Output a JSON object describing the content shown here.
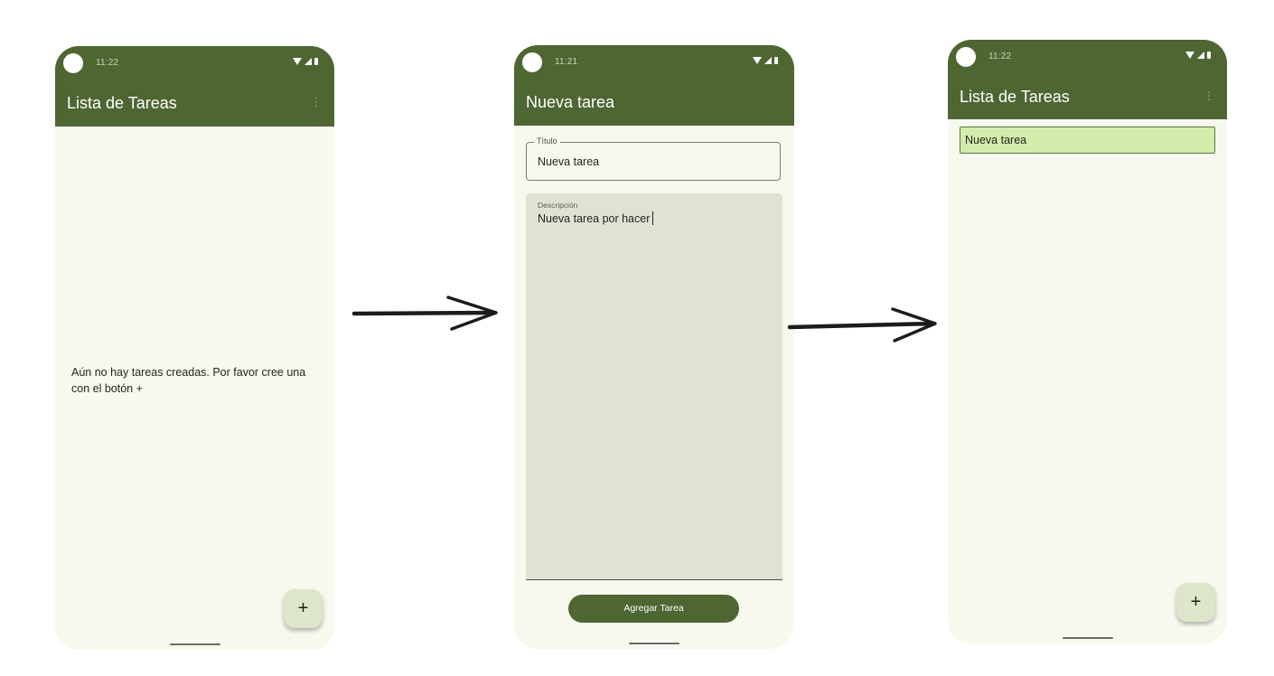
{
  "screens": [
    {
      "status_time": "11:22",
      "title": "Lista de Tareas",
      "empty_message": "Aún no hay tareas creadas. Por favor cree una con el botón +",
      "fab_label": "+"
    },
    {
      "status_time": "11:21",
      "title": "Nueva tarea",
      "title_field": {
        "label": "Título",
        "value": "Nueva tarea"
      },
      "description_field": {
        "label": "Descripción",
        "value": "Nueva tarea por hacer"
      },
      "submit_label": "Agregar Tarea"
    },
    {
      "status_time": "11:22",
      "title": "Lista de Tareas",
      "tasks": [
        {
          "title": "Nueva tarea"
        }
      ],
      "fab_label": "+"
    }
  ],
  "colors": {
    "app_bar": "#4e6632",
    "background": "#f7f9ef",
    "task_item": "#d4ecab",
    "fab": "#dde6c9"
  },
  "icons": [
    "front-camera-icon",
    "wifi-icon",
    "signal-icon",
    "battery-icon",
    "more-vert-icon",
    "add-icon",
    "flow-arrow-icon"
  ]
}
